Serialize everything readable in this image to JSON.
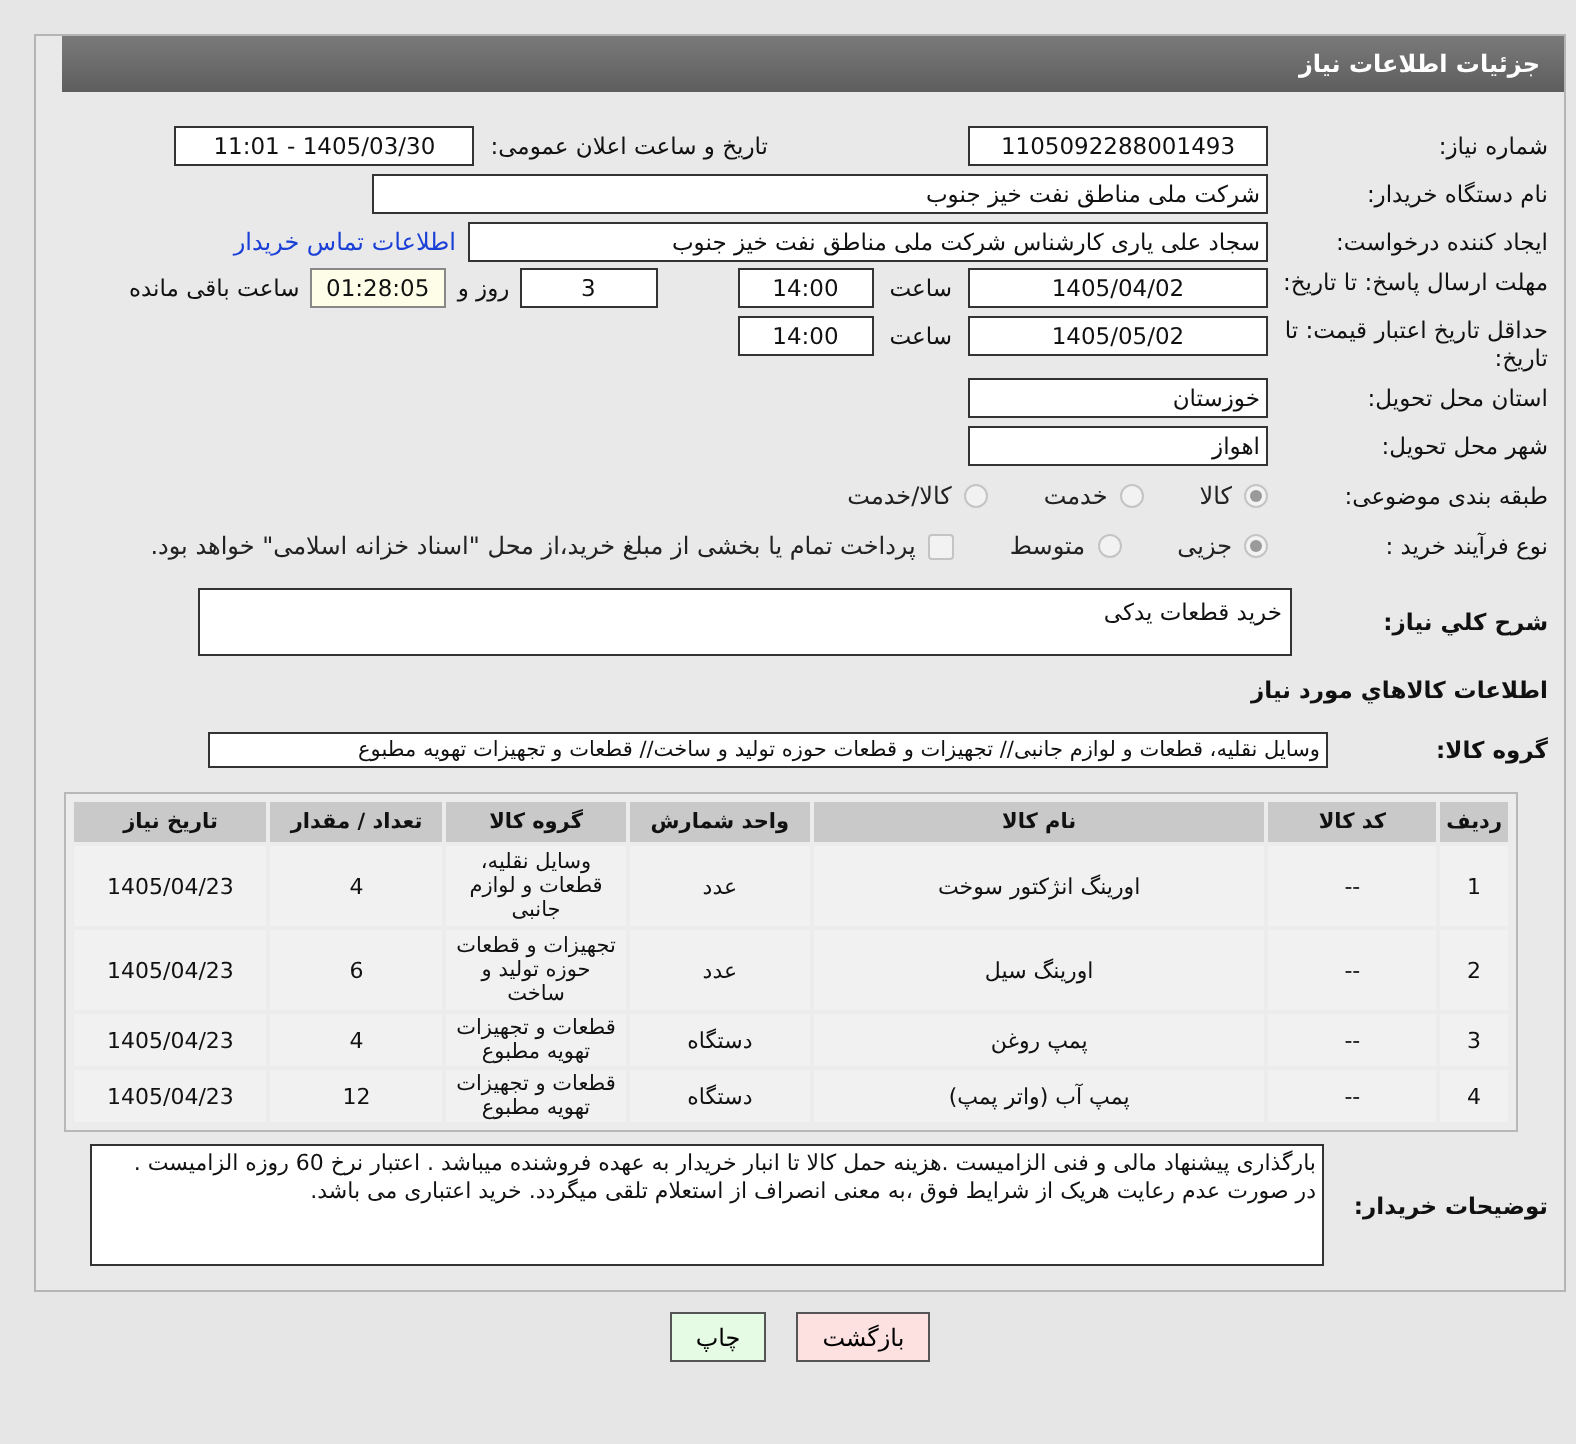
{
  "header": {
    "title": "جزئیات اطلاعات نیاز"
  },
  "need_number": {
    "label": "شماره نیاز:",
    "value": "1105092288001493"
  },
  "announce_datetime": {
    "label": "تاریخ و ساعت اعلان عمومی:",
    "value": "1405/03/30 - 11:01"
  },
  "buyer_org": {
    "label": "نام دستگاه خریدار:",
    "value": "شرکت ملی مناطق نفت خیز جنوب"
  },
  "requester": {
    "label": "ایجاد کننده درخواست:",
    "value": "سجاد علی یاری کارشناس شرکت ملی مناطق نفت خیز جنوب",
    "link": "اطلاعات تماس خریدار"
  },
  "response_deadline": {
    "label": "مهلت ارسال پاسخ: تا تاریخ:",
    "date": "1405/04/02",
    "time_label": "ساعت",
    "time": "14:00",
    "days": "3",
    "days_label": "روز و",
    "countdown": "01:28:05",
    "countdown_label": "ساعت باقی مانده"
  },
  "price_validity": {
    "label": "حداقل تاریخ اعتبار قیمت: تا تاریخ:",
    "date": "1405/05/02",
    "time_label": "ساعت",
    "time": "14:00"
  },
  "delivery_province": {
    "label": "استان محل تحویل:",
    "value": "خوزستان"
  },
  "delivery_city": {
    "label": "شهر محل تحویل:",
    "value": "اهواز"
  },
  "category": {
    "label": "طبقه بندی موضوعی:",
    "options": [
      {
        "label": "کالا",
        "selected": true
      },
      {
        "label": "خدمت",
        "selected": false
      },
      {
        "label": "کالا/خدمت",
        "selected": false
      }
    ]
  },
  "process": {
    "label": "نوع فرآیند خرید :",
    "options": [
      {
        "label": "جزیی",
        "selected": true
      },
      {
        "label": "متوسط",
        "selected": false
      }
    ],
    "treasury": {
      "label": "پرداخت تمام یا بخشی از مبلغ خرید،از محل \"اسناد خزانه اسلامی\" خواهد بود.",
      "checked": false
    }
  },
  "description": {
    "label": "شرح کلي نیاز:",
    "value": "خرید قطعات یدکی"
  },
  "items_heading": "اطلاعات کالاهاي مورد نیاز",
  "goods_group": {
    "label": "گروه کالا:",
    "value": "وسایل نقلیه، قطعات و لوازم جانبی// تجهیزات و قطعات حوزه تولید و ساخت//  قطعات و تجهیزات تهویه مطبوع"
  },
  "table": {
    "columns": [
      "ردیف",
      "کد کالا",
      "نام کالا",
      "واحد شمارش",
      "گروه کالا",
      "تعداد / مقدار",
      "تاریخ نیاز"
    ],
    "rows": [
      [
        "1",
        "--",
        "اورینگ انژکتور سوخت",
        "عدد",
        "وسایل نقلیه، قطعات و لوازم جانبی",
        "4",
        "1405/04/23"
      ],
      [
        "2",
        "--",
        "اورینگ سیل",
        "عدد",
        "تجهیزات و قطعات حوزه تولید و ساخت",
        "6",
        "1405/04/23"
      ],
      [
        "3",
        "--",
        "پمپ روغن",
        "دستگاه",
        "قطعات و تجهیزات تهویه مطبوع",
        "4",
        "1405/04/23"
      ],
      [
        "4",
        "--",
        "پمپ آب (واتر پمپ)",
        "دستگاه",
        "قطعات و تجهیزات تهویه مطبوع",
        "12",
        "1405/04/23"
      ]
    ]
  },
  "buyer_notes": {
    "label": "توضیحات خریدار:",
    "value": "بارگذاری پیشنهاد مالی و فنی الزامیست .هزینه حمل کالا تا انبار خریدار به عهده فروشنده میباشد . اعتبار نرخ 60 روزه الزامیست .\nدر صورت عدم رعایت هریک از شرایط فوق ،به معنی انصراف از استعلام تلقی میگردد. خرید اعتباری می باشد."
  },
  "buttons": [
    {
      "label": "بازگشت",
      "kind": "back"
    },
    {
      "label": "چاپ",
      "kind": "print"
    }
  ]
}
